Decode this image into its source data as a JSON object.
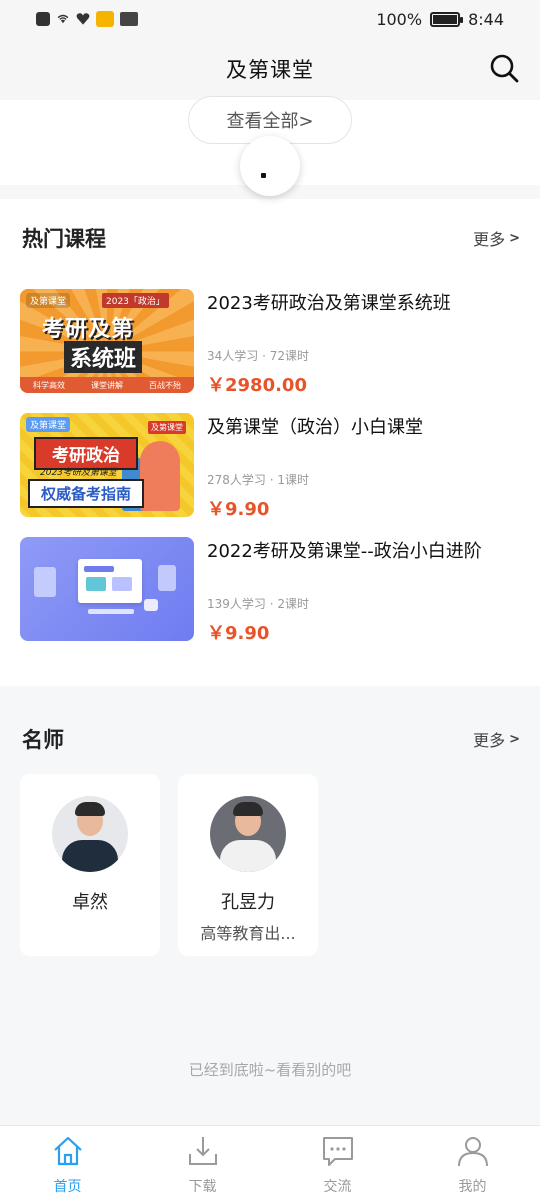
{
  "status_bar": {
    "battery_text": "100%",
    "battery_level": 1.0,
    "time": "8:44",
    "icons": [
      "alert-icon",
      "wifi-icon",
      "heart-rate-icon",
      "weibo-icon",
      "hms-icon"
    ]
  },
  "header": {
    "title": "及第课堂",
    "search_icon": "search-icon"
  },
  "top": {
    "view_all_label": "查看全部>"
  },
  "hot_courses": {
    "title": "热门课程",
    "more_label": "更多",
    "more_chevron": ">",
    "items": [
      {
        "title": "2023考研政治及第课堂系统班",
        "meta": "34人学习 · 72课时",
        "price": "￥2980.00",
        "thumb": {
          "tag": "及第课堂",
          "badge": "2023「政治」",
          "line1": "考研及第",
          "line2": "系统班",
          "foot": [
            "科学高效",
            "课堂讲解",
            "百战不殆"
          ]
        }
      },
      {
        "title": "及第课堂（政治）小白课堂",
        "meta": "278人学习 · 1课时",
        "price": "￥9.90",
        "thumb": {
          "tag": "及第课堂",
          "corner": "及第课堂",
          "line1": "考研政治",
          "line2": "2023考研及第课堂",
          "line3": "权威备考指南"
        }
      },
      {
        "title": "2022考研及第课堂--政治小白进阶",
        "meta": "139人学习 · 2课时",
        "price": "￥9.90"
      }
    ]
  },
  "teachers": {
    "title": "名师",
    "more_label": "更多",
    "more_chevron": ">",
    "items": [
      {
        "name": "卓然",
        "desc": ""
      },
      {
        "name": "孔昱力",
        "desc": "高等教育出版社"
      }
    ]
  },
  "footer": {
    "end_text": "已经到底啦~看看别的吧"
  },
  "tab_bar": {
    "tabs": [
      {
        "label": "首页",
        "icon": "home-icon",
        "active": true
      },
      {
        "label": "下载",
        "icon": "download-icon",
        "active": false
      },
      {
        "label": "交流",
        "icon": "chat-icon",
        "active": false
      },
      {
        "label": "我的",
        "icon": "profile-icon",
        "active": false
      }
    ]
  },
  "colors": {
    "accent": "#2a9ff3",
    "price": "#e8542a",
    "header_bg": "#f6f6f6"
  }
}
